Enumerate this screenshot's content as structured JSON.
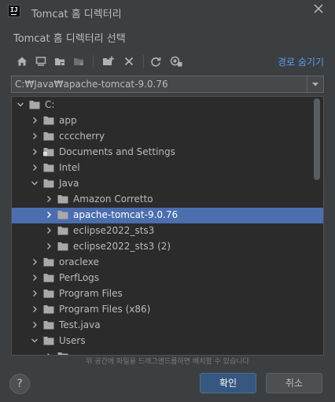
{
  "window": {
    "title": "Tomcat 홈 디렉터리",
    "logo_text": "IJ"
  },
  "dialog": {
    "subtitle": "Tomcat 홈 디렉터리 선택"
  },
  "toolbar": {
    "hide_path_label": "경로 숨기기",
    "icons": [
      "home-icon",
      "desktop-icon",
      "project-folder-icon",
      "module-folder-icon",
      "new-folder-icon",
      "delete-icon",
      "refresh-icon",
      "show-hidden-icon"
    ]
  },
  "path": {
    "value": "C:₩Java₩apache-tomcat-9.0.76"
  },
  "tree": {
    "rows": [
      {
        "label": "C:",
        "level": 0,
        "expanded": true,
        "selected": false
      },
      {
        "label": "app",
        "level": 1,
        "expanded": false,
        "selected": false
      },
      {
        "label": "ccccherry",
        "level": 1,
        "expanded": false,
        "selected": false
      },
      {
        "label": "Documents and Settings",
        "level": 1,
        "expanded": false,
        "selected": false,
        "link": true
      },
      {
        "label": "Intel",
        "level": 1,
        "expanded": false,
        "selected": false
      },
      {
        "label": "Java",
        "level": 1,
        "expanded": true,
        "selected": false
      },
      {
        "label": "Amazon Corretto",
        "level": 2,
        "expanded": false,
        "selected": false
      },
      {
        "label": "apache-tomcat-9.0.76",
        "level": 2,
        "expanded": false,
        "selected": true
      },
      {
        "label": "eclipse2022_sts3",
        "level": 2,
        "expanded": false,
        "selected": false
      },
      {
        "label": "eclipse2022_sts3 (2)",
        "level": 2,
        "expanded": false,
        "selected": false
      },
      {
        "label": "oraclexe",
        "level": 1,
        "expanded": false,
        "selected": false
      },
      {
        "label": "PerfLogs",
        "level": 1,
        "expanded": false,
        "selected": false
      },
      {
        "label": "Program Files",
        "level": 1,
        "expanded": false,
        "selected": false
      },
      {
        "label": "Program Files (x86)",
        "level": 1,
        "expanded": false,
        "selected": false
      },
      {
        "label": "Test.java",
        "level": 1,
        "expanded": false,
        "selected": false
      },
      {
        "label": "Users",
        "level": 1,
        "expanded": true,
        "selected": false
      },
      {
        "label": "",
        "level": 2,
        "expanded": false,
        "selected": false
      }
    ]
  },
  "drop_hint": "위 공간에 파일을 드래그앤드롭하면 배치할 수 있습니다",
  "buttons": {
    "help": "?",
    "ok": "확인",
    "cancel": "취소"
  },
  "colors": {
    "accent": "#4b6eaf",
    "link": "#589df6",
    "primary_button": "#365880"
  }
}
